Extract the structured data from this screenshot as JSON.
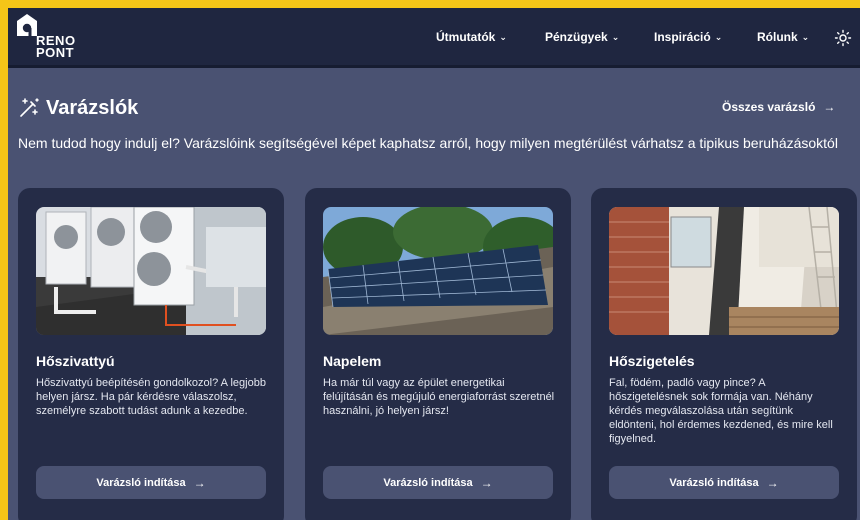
{
  "logo": {
    "line1": "RENO",
    "line2": "PONT"
  },
  "nav": [
    {
      "label": "Útmutatók"
    },
    {
      "label": "Pénzügyek"
    },
    {
      "label": "Inspiráció"
    },
    {
      "label": "Rólunk"
    }
  ],
  "section": {
    "title": "Varázslók",
    "all_link": "Összes varázsló",
    "intro": "Nem tudod hogy indulj el? Varázslóink segítségével képet kaphatsz arról, hogy milyen megtérülést várhatsz a tipikus beruházásoktól"
  },
  "cards": [
    {
      "title": "Hőszivattyú",
      "description": "Hőszivattyú beépítésén gondolkozol? A legjobb helyen jársz. Ha pár kérdésre válaszolsz, személyre szabott tudást adunk a kezedbe.",
      "button": "Varázsló indítása"
    },
    {
      "title": "Napelem",
      "description": "Ha már túl vagy az épület energetikai felújításán és megújuló energiaforrást szeretnél használni, jó helyen jársz!",
      "button": "Varázsló indítása"
    },
    {
      "title": "Hőszigetelés",
      "description": "Fal, födém, padló vagy pince? A hőszigetelésnek sok formája van. Néhány kérdés megválaszolása után segítünk eldönteni, hol érdemes kezdened, és mire kell figyelned.",
      "button": "Varázsló indítása"
    }
  ],
  "icons": {
    "arrow": "→",
    "chevron": "⌄"
  },
  "colors": {
    "frame": "#f5c518",
    "nav_bg": "#1f2640",
    "page_bg": "#4a5272",
    "card_bg": "#252c47"
  }
}
